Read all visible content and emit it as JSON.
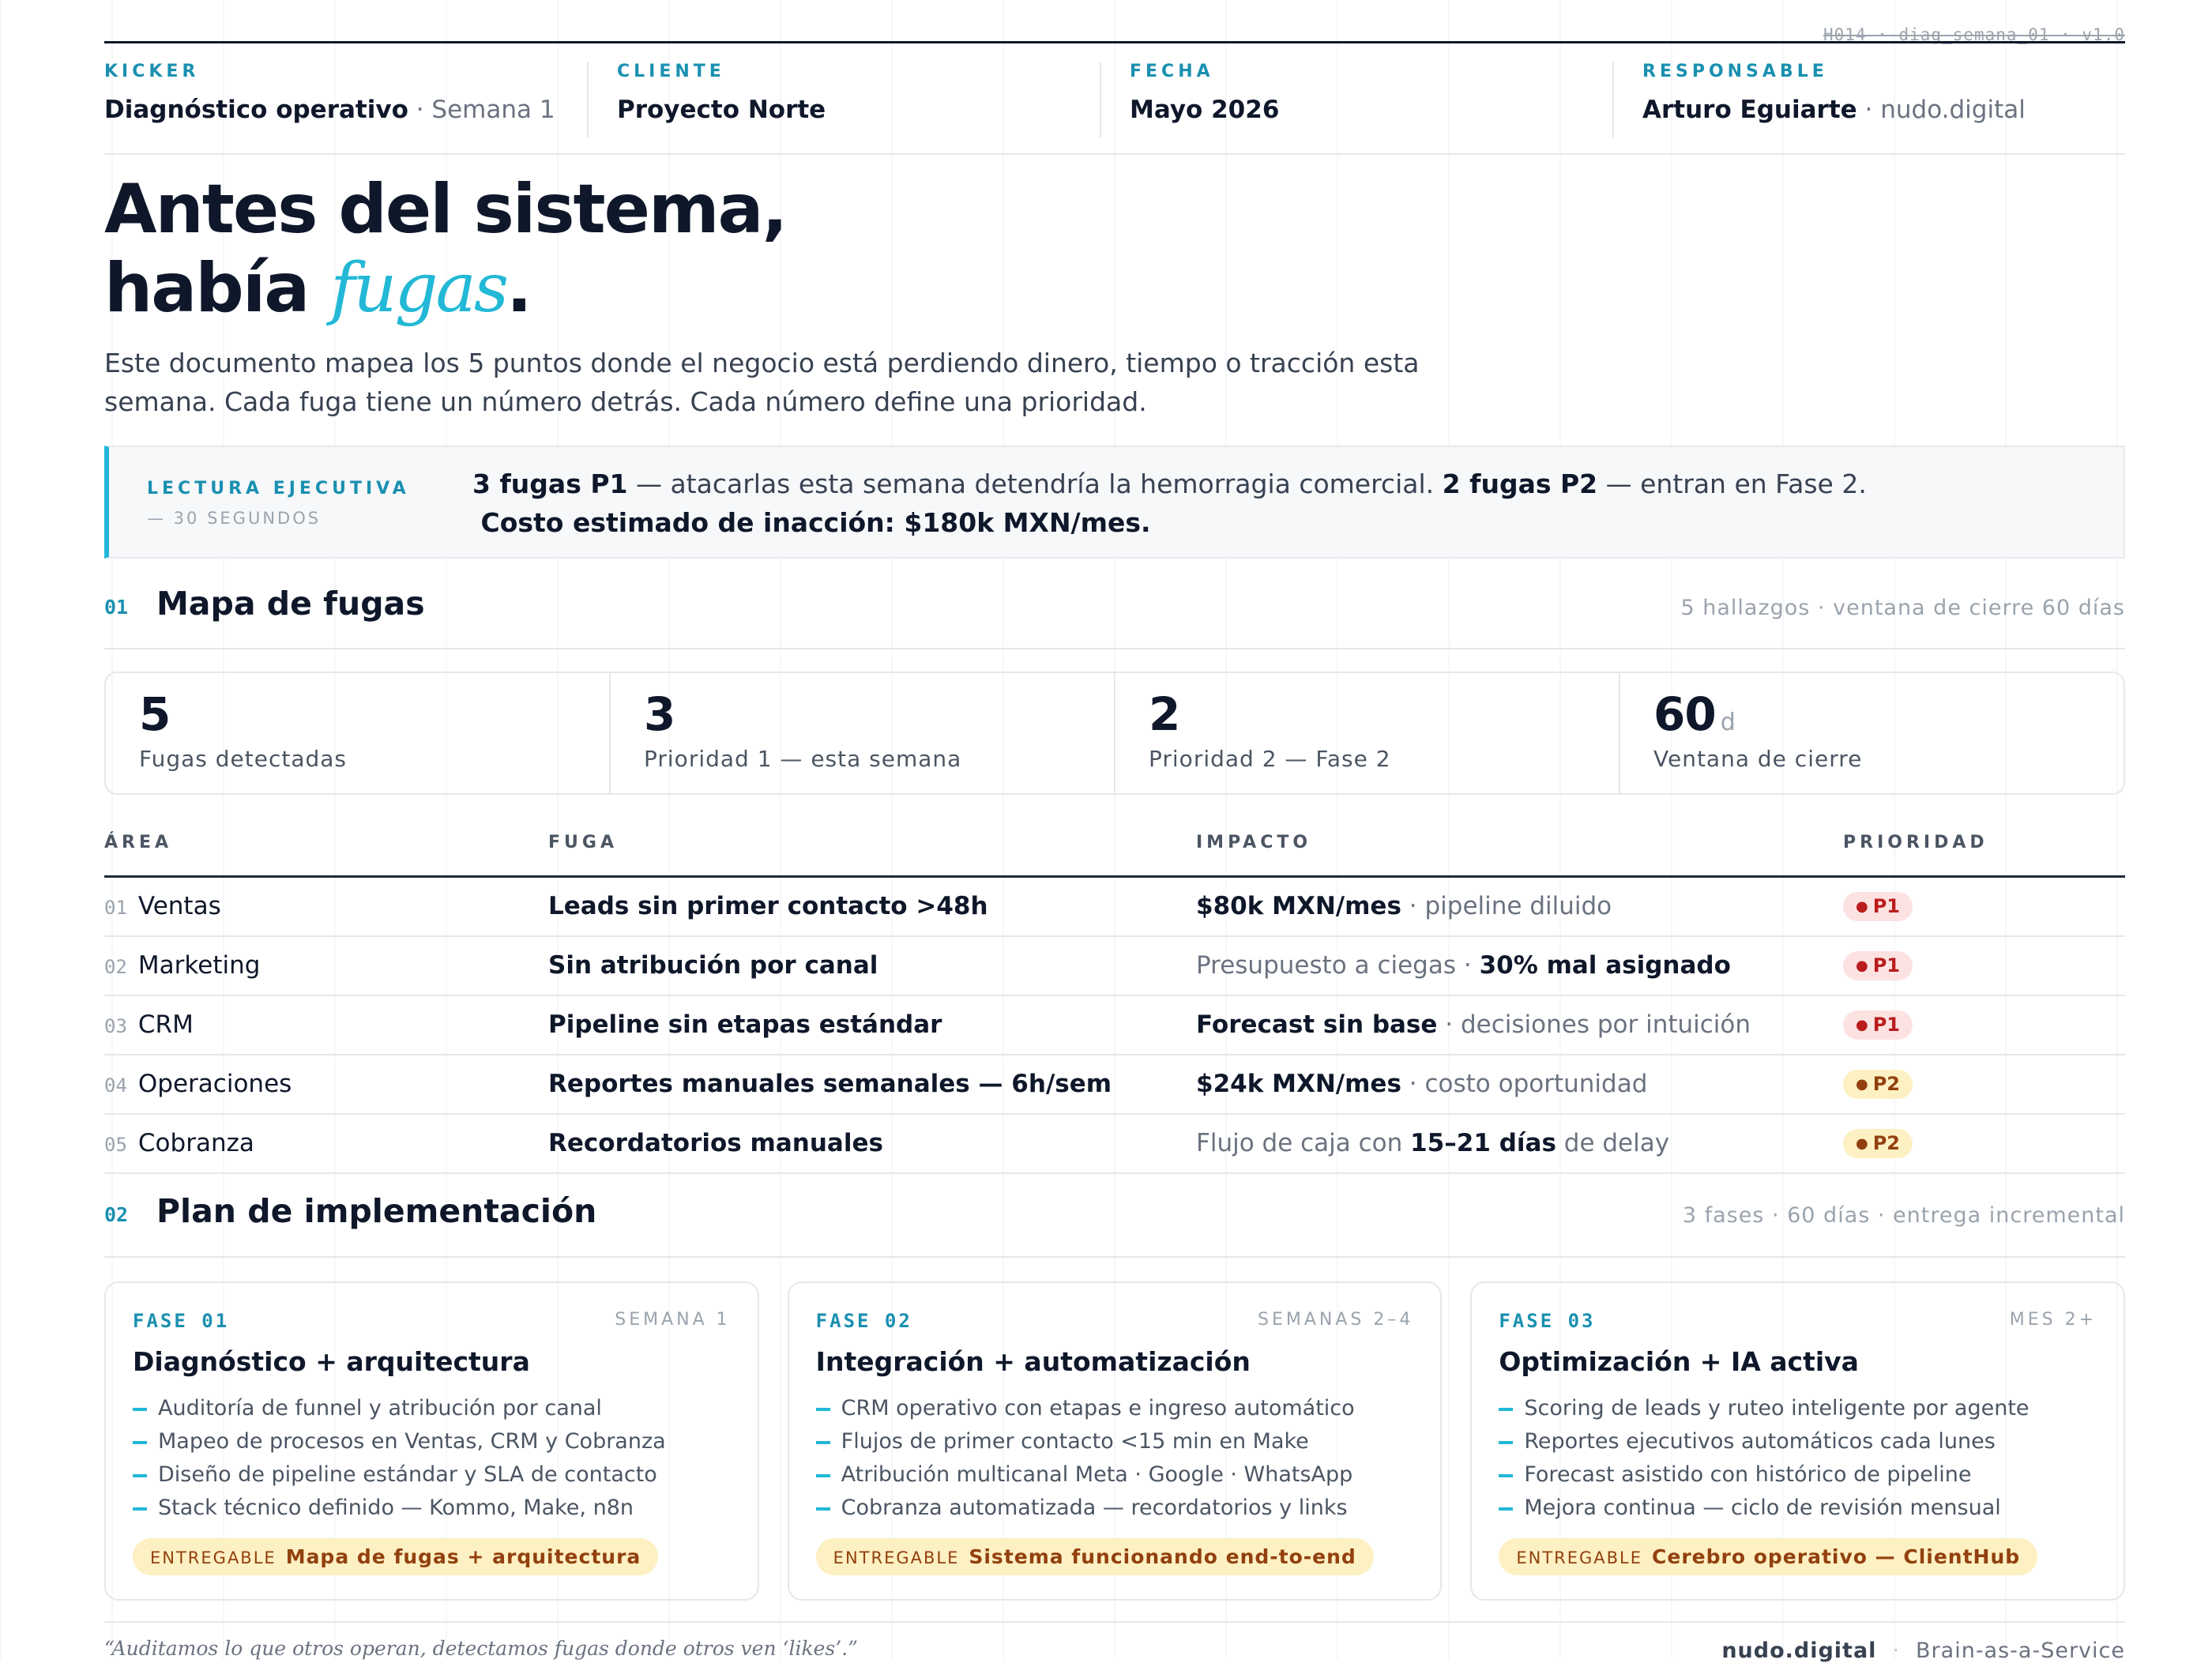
{
  "doc_ref": "H014 · diag_semana_01 · v1.0",
  "meta": [
    {
      "label": "KICKER",
      "value": "Diagnóstico operativo",
      "sub": " · Semana 1"
    },
    {
      "label": "CLIENTE",
      "value": "Proyecto Norte",
      "sub": ""
    },
    {
      "label": "FECHA",
      "value": "Mayo 2026",
      "sub": ""
    },
    {
      "label": "RESPONSABLE",
      "value": "Arturo Eguiarte",
      "sub": " · nudo.digital"
    }
  ],
  "hero": {
    "line1": "Antes del sistema,",
    "line2_pre": "había ",
    "accent": "fugas",
    "end": "."
  },
  "lede": "Este documento mapea los 5 puntos donde el negocio está perdiendo dinero, tiempo o tracción esta semana. Cada fuga tiene un número detrás. Cada número define una prioridad.",
  "exec": {
    "label": "LECTURA EJECUTIVA",
    "sub": "— 30 SEGUNDOS",
    "b1": "3 fugas P1",
    "t1": " — atacarlas esta semana detendría la hemorragia comercial. ",
    "b2": "2 fugas P2",
    "t2": " — entran en Fase 2.",
    "t3": "Costo estimado de inacción: ",
    "b3": "$180k MXN/mes."
  },
  "sec1": {
    "num": "01",
    "title": "Mapa de fugas",
    "note": "5 hallazgos · ventana de cierre 60 días"
  },
  "stats": [
    {
      "value": "5",
      "unit": "",
      "label": "Fugas detectadas"
    },
    {
      "value": "3",
      "unit": "",
      "label": "Prioridad 1 — esta semana"
    },
    {
      "value": "2",
      "unit": "",
      "label": "Prioridad 2 — Fase 2"
    },
    {
      "value": "60",
      "unit": "d",
      "label": "Ventana de cierre"
    }
  ],
  "table": {
    "headers": {
      "area": "ÁREA",
      "fuga": "FUGA",
      "impacto": "IMPACTO",
      "prioridad": "PRIORIDAD"
    },
    "rows": [
      {
        "num": "01",
        "area": "Ventas",
        "fuga": "Leads sin primer contacto >48h",
        "imp_pre": "",
        "imp_b": "$80k MXN/mes",
        "imp_post": " · pipeline diluido",
        "pri": "P1"
      },
      {
        "num": "02",
        "area": "Marketing",
        "fuga": "Sin atribución por canal",
        "imp_pre": "Presupuesto a ciegas · ",
        "imp_b": "30% mal asignado",
        "imp_post": "",
        "pri": "P1"
      },
      {
        "num": "03",
        "area": "CRM",
        "fuga": "Pipeline sin etapas estándar",
        "imp_pre": "",
        "imp_b": "Forecast sin base",
        "imp_post": " · decisiones por intuición",
        "pri": "P1"
      },
      {
        "num": "04",
        "area": "Operaciones",
        "fuga": "Reportes manuales semanales — 6h/sem",
        "imp_pre": "",
        "imp_b": "$24k MXN/mes",
        "imp_post": " · costo oportunidad",
        "pri": "P2"
      },
      {
        "num": "05",
        "area": "Cobranza",
        "fuga": "Recordatorios manuales",
        "imp_pre": "Flujo de caja con ",
        "imp_b": "15–21 días",
        "imp_post": " de delay",
        "pri": "P2"
      }
    ]
  },
  "sec2": {
    "num": "02",
    "title": "Plan de implementación",
    "note": "3 fases · 60 días · entrega incremental"
  },
  "phases": [
    {
      "num": "FASE 01",
      "when": "SEMANA 1",
      "title": "Diagnóstico + arquitectura",
      "items": [
        "Auditoría de funnel y atribución por canal",
        "Mapeo de procesos en Ventas, CRM y Cobranza",
        "Diseño de pipeline estándar y SLA de contacto",
        "Stack técnico definido — Kommo, Make, n8n"
      ],
      "deliv_label": "ENTREGABLE",
      "deliv": "Mapa de fugas + arquitectura"
    },
    {
      "num": "FASE 02",
      "when": "SEMANAS 2–4",
      "title": "Integración + automatización",
      "items": [
        "CRM operativo con etapas e ingreso automático",
        "Flujos de primer contacto <15 min en Make",
        "Atribución multicanal Meta · Google · WhatsApp",
        "Cobranza automatizada — recordatorios y links"
      ],
      "deliv_label": "ENTREGABLE",
      "deliv": "Sistema funcionando end-to-end"
    },
    {
      "num": "FASE 03",
      "when": "MES 2+",
      "title": "Optimización + IA activa",
      "items": [
        "Scoring de leads y ruteo inteligente por agente",
        "Reportes ejecutivos automáticos cada lunes",
        "Forecast asistido con histórico de pipeline",
        "Mejora continua — ciclo de revisión mensual"
      ],
      "deliv_label": "ENTREGABLE",
      "deliv": "Cerebro operativo — ClientHub"
    }
  ],
  "footer": {
    "quote": "“Auditamos lo que otros operan, detectamos fugas donde otros ven ‘likes’.”",
    "brand": "nudo.digital",
    "sep": "·",
    "tagline": "Brain-as-a-Service"
  },
  "colors": {
    "accent": "#22b8d6",
    "label": "#1a90b0",
    "p1_bg": "#fde2e2",
    "p1_fg": "#b91c1c",
    "p2_bg": "#fdf0c2",
    "p2_fg": "#92400e",
    "ink": "#0f172a"
  }
}
